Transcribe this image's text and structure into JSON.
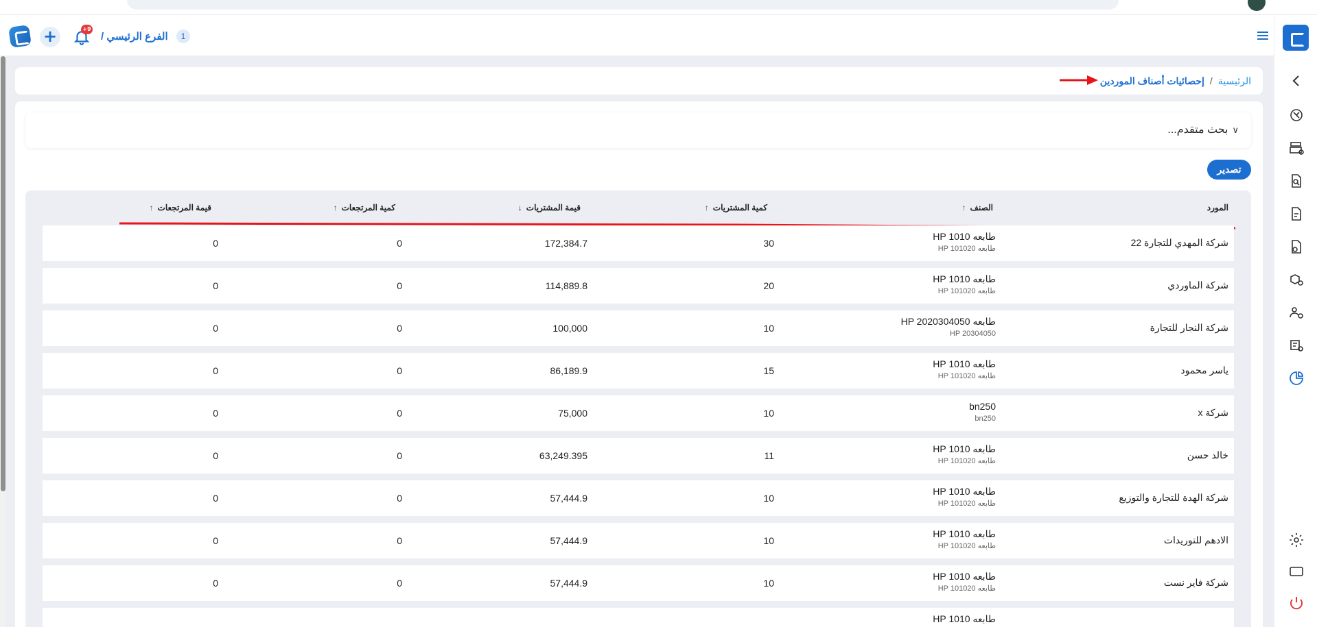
{
  "header": {
    "branch_label": "الفرع الرئيسي /",
    "branch_count": "1",
    "notification_badge": "+9"
  },
  "breadcrumb": {
    "home": "الرئيسية",
    "separator": "/",
    "current": "إحصائيات أصناف الموردين"
  },
  "search": {
    "advanced_label": "بحث متقدم..."
  },
  "toolbar": {
    "export_label": "تصدير"
  },
  "table": {
    "columns": {
      "supplier": "المورد",
      "item": "الصنف",
      "purchase_qty": "كمية المشتريات",
      "purchase_value": "قيمة المشتريات",
      "returns_qty": "كمية المرتجعات",
      "returns_value": "قيمة المرتجعات"
    },
    "sort_arrows": {
      "item": "↑",
      "purchase_qty": "↑",
      "purchase_value": "↓",
      "returns_qty": "↑",
      "returns_value": "↑"
    },
    "rows": [
      {
        "supplier": "شركة المهدي للتجارة 22",
        "item_name": "طابعه HP 1010",
        "item_code": "طابعه HP 101020",
        "purchase_qty": "30",
        "purchase_value": "172,384.7",
        "returns_qty": "0",
        "returns_value": "0"
      },
      {
        "supplier": "شركة الماوردي",
        "item_name": "طابعه HP 1010",
        "item_code": "طابعه HP 101020",
        "purchase_qty": "20",
        "purchase_value": "114,889.8",
        "returns_qty": "0",
        "returns_value": "0"
      },
      {
        "supplier": "شركة النجار للتجارة",
        "item_name": "طابعه HP 2020304050",
        "item_code": "HP 20304050",
        "purchase_qty": "10",
        "purchase_value": "100,000",
        "returns_qty": "0",
        "returns_value": "0"
      },
      {
        "supplier": "ياسر محمود",
        "item_name": "طابعه HP 1010",
        "item_code": "طابعه HP 101020",
        "purchase_qty": "15",
        "purchase_value": "86,189.9",
        "returns_qty": "0",
        "returns_value": "0"
      },
      {
        "supplier": "شركة x",
        "item_name": "bn250",
        "item_code": "bn250",
        "purchase_qty": "10",
        "purchase_value": "75,000",
        "returns_qty": "0",
        "returns_value": "0"
      },
      {
        "supplier": "خالد حسن",
        "item_name": "طابعه HP 1010",
        "item_code": "طابعه HP 101020",
        "purchase_qty": "11",
        "purchase_value": "63,249.395",
        "returns_qty": "0",
        "returns_value": "0"
      },
      {
        "supplier": "شركة الهدة للتجارة والتوزيع",
        "item_name": "طابعه HP 1010",
        "item_code": "طابعه HP 101020",
        "purchase_qty": "10",
        "purchase_value": "57,444.9",
        "returns_qty": "0",
        "returns_value": "0"
      },
      {
        "supplier": "الادهم للتوريدات",
        "item_name": "طابعه HP 1010",
        "item_code": "طابعه HP 101020",
        "purchase_qty": "10",
        "purchase_value": "57,444.9",
        "returns_qty": "0",
        "returns_value": "0"
      },
      {
        "supplier": "شركة فاير نست",
        "item_name": "طابعه HP 1010",
        "item_code": "طابعه HP 101020",
        "purchase_qty": "10",
        "purchase_value": "57,444.9",
        "returns_qty": "0",
        "returns_value": "0"
      },
      {
        "supplier": "",
        "item_name": "طابعه HP 1010",
        "item_code": "",
        "purchase_qty": "",
        "purchase_value": "",
        "returns_qty": "",
        "returns_value": ""
      }
    ]
  },
  "colors": {
    "accent": "#1c6fd1",
    "annotation_red": "#e8141b",
    "badge_red": "#e23b3b",
    "page_bg": "#eceef3"
  },
  "icons": {
    "sidebar": [
      "chevron-left-icon",
      "dashboard-gauge-icon",
      "cash-register-icon",
      "search-document-icon",
      "invoice-icon",
      "document-settings-icon",
      "boxes-settings-icon",
      "users-settings-icon",
      "inventory-settings-icon",
      "reports-chart-icon",
      "gear-icon",
      "window-icon",
      "power-icon"
    ]
  }
}
